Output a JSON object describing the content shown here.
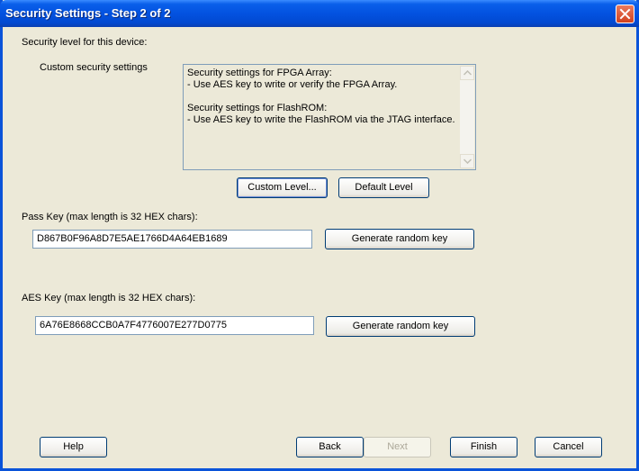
{
  "window": {
    "title": "Security Settings - Step 2 of 2"
  },
  "security": {
    "level_label": "Security level for this device:",
    "custom_label": "Custom security settings",
    "description": "Security settings for FPGA Array:\n- Use AES key to write or verify the FPGA Array.\n\nSecurity settings for FlashROM:\n- Use AES key to write the FlashROM via the JTAG interface.",
    "custom_level_button": "Custom Level...",
    "default_level_button": "Default Level"
  },
  "pass_key": {
    "label": "Pass Key (max length is 32 HEX chars):",
    "value": "D867B0F96A8D7E5AE1766D4A64EB1689",
    "generate_button": "Generate random key"
  },
  "aes_key": {
    "label": "AES Key (max length is 32 HEX chars):",
    "value": "6A76E8668CCB0A7F4776007E277D0775",
    "generate_button": "Generate random key"
  },
  "footer": {
    "help": "Help",
    "back": "Back",
    "next": "Next",
    "finish": "Finish",
    "cancel": "Cancel"
  },
  "colors": {
    "titlebar": "#0352E0",
    "close": "#D2411E",
    "face": "#ECE9D8",
    "button_border": "#003C74"
  },
  "icons": {
    "close": "close-icon",
    "scroll_up": "scroll-up-arrow-icon",
    "scroll_down": "scroll-down-arrow-icon"
  }
}
